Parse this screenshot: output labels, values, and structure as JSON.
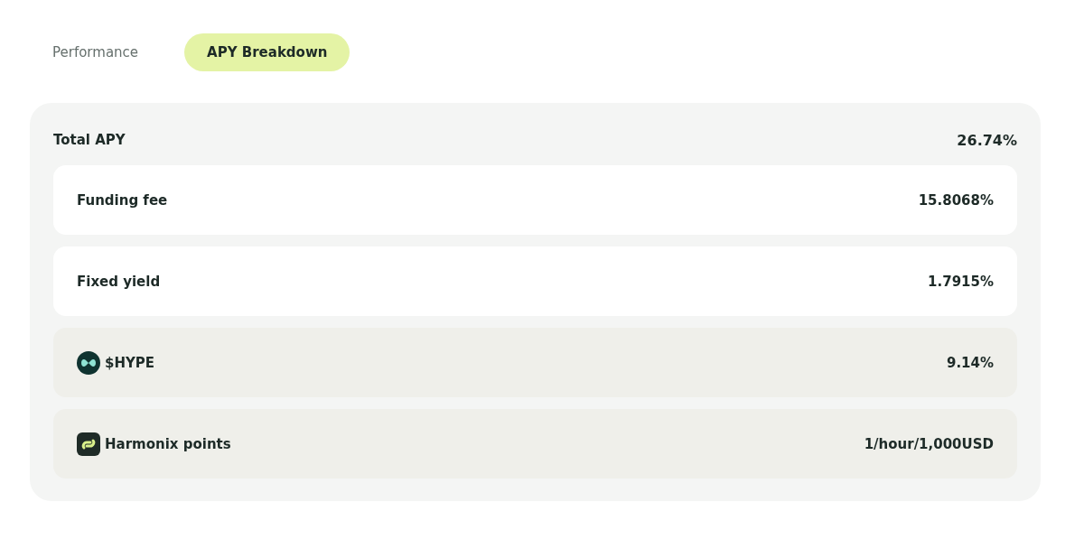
{
  "tabs": [
    {
      "label": "Performance",
      "selected": false
    },
    {
      "label": "APY Breakdown",
      "selected": true
    }
  ],
  "total": {
    "label": "Total APY",
    "value": "26.74%"
  },
  "rows": [
    {
      "kind": "plain",
      "label": "Funding fee",
      "value": "15.8068%"
    },
    {
      "kind": "plain",
      "label": "Fixed yield",
      "value": "1.7915%"
    },
    {
      "kind": "hype",
      "label": "$HYPE",
      "value": "9.14%"
    },
    {
      "kind": "points",
      "label": "Harmonix points",
      "value": "1/hour/1,000USD"
    }
  ]
}
